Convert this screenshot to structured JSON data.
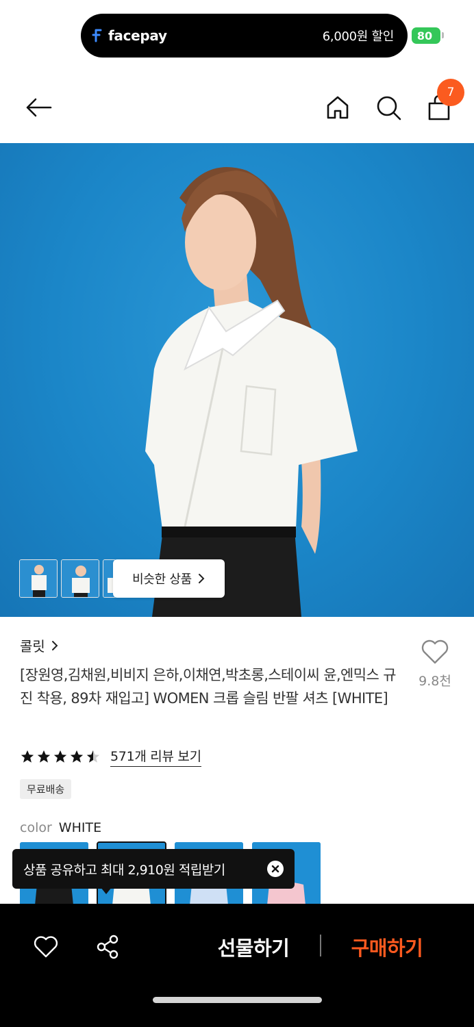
{
  "status": {
    "pay_brand": "facepay",
    "pay_discount": "6,000원 할인",
    "battery": "80"
  },
  "nav": {
    "badge_count": "7"
  },
  "hero": {
    "similar_button": "비슷한 상품"
  },
  "product": {
    "brand": "콜릿",
    "title": "[장원영,김채원,비비지 은하,이채연,박초롱,스테이씨 윤,엔믹스 규진 착용, 89차 재입고] WOMEN 크롭 슬림 반팔 셔츠 [WHITE]",
    "like_count": "9.8천",
    "rating": 4.5,
    "review_link": "571개 리뷰 보기",
    "shipping_badge": "무료배송",
    "color_label": "color",
    "color_value": "WHITE"
  },
  "toast": {
    "message": "상품 공유하고 최대 2,910원 적립받기"
  },
  "bottom": {
    "gift_label": "선물하기",
    "buy_label": "구매하기"
  },
  "colors": {
    "accent": "#ff5a1f",
    "badge": "#fb5b1f",
    "battery": "#34c759",
    "hero_bg": "#1b86c8"
  }
}
